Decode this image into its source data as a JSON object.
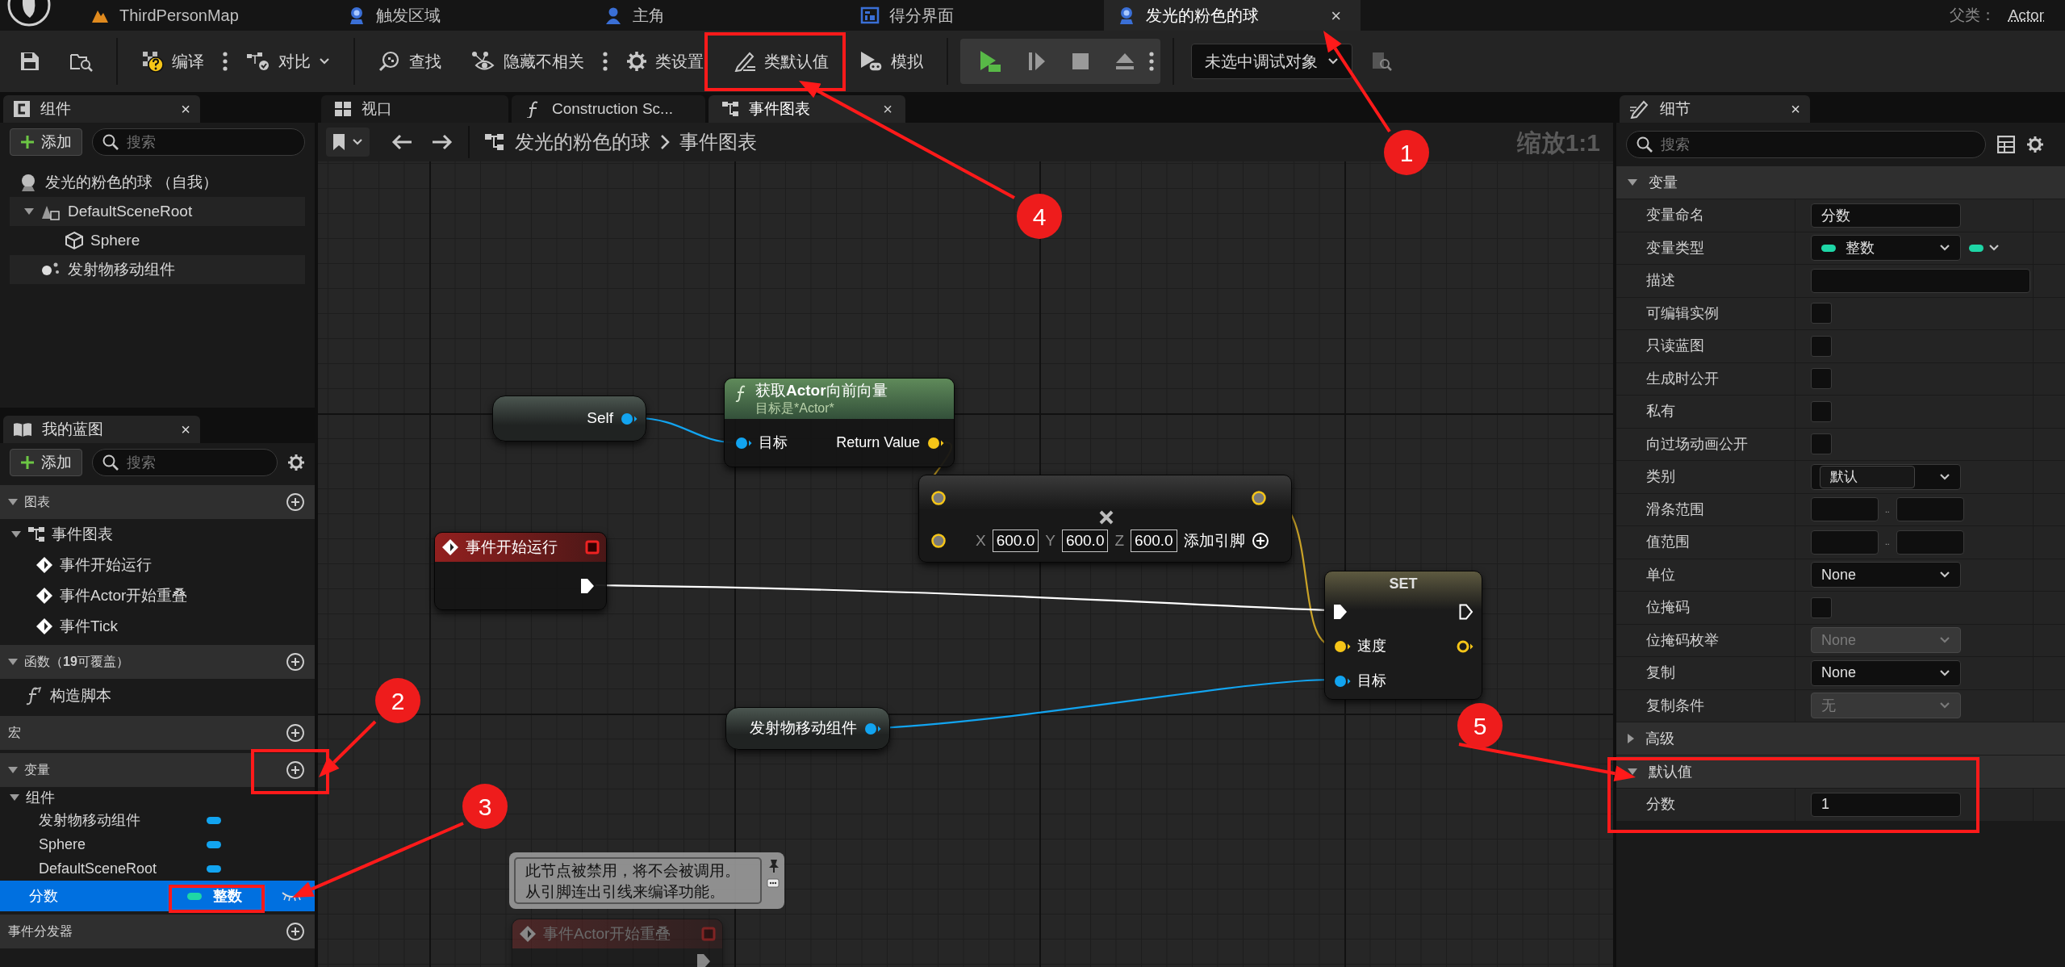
{
  "editor_tabs": [
    {
      "label": "ThirdPersonMap",
      "selected": false
    },
    {
      "label": "触发区域",
      "selected": false
    },
    {
      "label": "主角",
      "selected": false
    },
    {
      "label": "得分界面",
      "selected": false
    },
    {
      "label": "发光的粉色的球",
      "selected": true,
      "close": "×"
    }
  ],
  "parent_class": {
    "label": "父类：",
    "value": "Actor"
  },
  "toolbar": {
    "compile": "编译",
    "diff": "对比",
    "find": "查找",
    "hide_unrelated": "隐藏不相关",
    "class_settings": "类设置",
    "class_defaults": "类默认值",
    "simulate": "模拟",
    "debug_object": "未选中调试对象"
  },
  "components": {
    "title": "组件",
    "close": "×",
    "add": "添加",
    "search_placeholder": "搜索",
    "tree": [
      {
        "label": "发光的粉色的球 （自我）",
        "children": [
          {
            "label": "DefaultSceneRoot",
            "expanded": true,
            "children": [
              {
                "label": "Sphere"
              }
            ]
          },
          {
            "label": "发射物移动组件"
          }
        ]
      }
    ]
  },
  "my_blueprint": {
    "title": "我的蓝图",
    "close": "×",
    "add": "添加",
    "search_placeholder": "搜索",
    "sections": [
      {
        "label": "图表",
        "expanded": true,
        "items": [
          {
            "kind": "graph",
            "label": "事件图表",
            "expanded": true,
            "children": [
              {
                "kind": "event",
                "label": "事件开始运行"
              },
              {
                "kind": "event",
                "label": "事件Actor开始重叠"
              },
              {
                "kind": "event",
                "label": "事件Tick"
              }
            ]
          }
        ]
      },
      {
        "label": "函数（**19**可覆盖）",
        "expanded": true,
        "items": [
          {
            "kind": "function",
            "label": "构造脚本"
          }
        ]
      },
      {
        "label": "宏"
      },
      {
        "label": "变量",
        "expanded": true,
        "items": [
          {
            "kind": "category",
            "label": "组件",
            "expanded": true,
            "children": [
              {
                "kind": "variable",
                "label": "发射物移动组件",
                "color": "#12a4f0",
                "selected": false
              },
              {
                "kind": "variable",
                "label": "Sphere",
                "color": "#12a4f0",
                "selected": false
              },
              {
                "kind": "variable",
                "label": "DefaultSceneRoot",
                "color": "#12a4f0",
                "selected": false
              }
            ]
          },
          {
            "kind": "variable",
            "label": "分数",
            "color": "#1ed6a6",
            "type": "整数",
            "selected": true
          }
        ]
      },
      {
        "label": "事件分发器"
      }
    ]
  },
  "graph": {
    "tabs": [
      {
        "label": "视口",
        "selected": false
      },
      {
        "label": "Construction Sc...",
        "selected": false
      },
      {
        "label": "事件图表",
        "selected": true,
        "close": "×"
      }
    ],
    "breadcrumb": [
      "发光的粉色的球",
      "事件图表"
    ],
    "zoom": "缩放1:1",
    "nodes": [
      {
        "kind": "variable",
        "label": "Self"
      },
      {
        "kind": "function",
        "title": "获取**Actor**向前向量",
        "subtitle": "目标是*Actor*",
        "input": "目标",
        "output": "Return Value"
      },
      {
        "kind": "math",
        "fields": [
          {
            "axis": "X",
            "value": "600.0"
          },
          {
            "axis": "Y",
            "value": "600.0"
          },
          {
            "axis": "Z",
            "value": "600.0"
          }
        ],
        "add_pin": "添加引脚"
      },
      {
        "kind": "event",
        "title": "事件开始运行",
        "disabled": false
      },
      {
        "kind": "set",
        "title": "SET",
        "inputs": [
          "速度",
          "目标"
        ]
      },
      {
        "kind": "variable",
        "label": "发射物移动组件"
      },
      {
        "kind": "comment",
        "lines": [
          "此节点被禁用，将不会被调用。",
          "从引脚连出引线来编译功能。"
        ]
      },
      {
        "kind": "event",
        "title": "事件Actor开始重叠",
        "disabled": true
      }
    ]
  },
  "details": {
    "title": "细节",
    "close": "×",
    "search_placeholder": "搜索",
    "sections": [
      {
        "label": "变量",
        "expanded": true,
        "rows": [
          {
            "kind": "text",
            "label": "变量命名",
            "value": "分数"
          },
          {
            "kind": "type",
            "label": "变量类型",
            "value": "整数",
            "color": "#1ed6a6"
          },
          {
            "kind": "textarea",
            "label": "描述"
          },
          {
            "kind": "checkbox",
            "label": "可编辑实例",
            "checked": false
          },
          {
            "kind": "checkbox",
            "label": "只读蓝图",
            "checked": false
          },
          {
            "kind": "checkbox",
            "label": "生成时公开",
            "checked": false
          },
          {
            "kind": "checkbox",
            "label": "私有",
            "checked": false
          },
          {
            "kind": "checkbox",
            "label": "向过场动画公开",
            "checked": false
          },
          {
            "kind": "combo",
            "label": "类别",
            "value": "默认"
          },
          {
            "kind": "range",
            "label": "滑条范围",
            "separator": ".."
          },
          {
            "kind": "range",
            "label": "值范围",
            "separator": ".."
          },
          {
            "kind": "dropdown",
            "label": "单位",
            "value": "None",
            "disabled": false
          },
          {
            "kind": "checkbox",
            "label": "位掩码",
            "checked": false
          },
          {
            "kind": "dropdown",
            "label": "位掩码枚举",
            "value": "None",
            "disabled": true
          },
          {
            "kind": "dropdown",
            "label": "复制",
            "value": "None",
            "disabled": false
          },
          {
            "kind": "dropdown",
            "label": "复制条件",
            "value": "无",
            "disabled": true
          }
        ]
      },
      {
        "label": "高级",
        "expanded": false
      },
      {
        "label": "默认值",
        "expanded": true,
        "rows": [
          {
            "kind": "text",
            "label": "分数",
            "value": "1"
          }
        ]
      }
    ]
  },
  "annotations": [
    {
      "label": "1"
    },
    {
      "label": "2"
    },
    {
      "label": "3"
    },
    {
      "label": "4"
    },
    {
      "label": "5"
    }
  ]
}
